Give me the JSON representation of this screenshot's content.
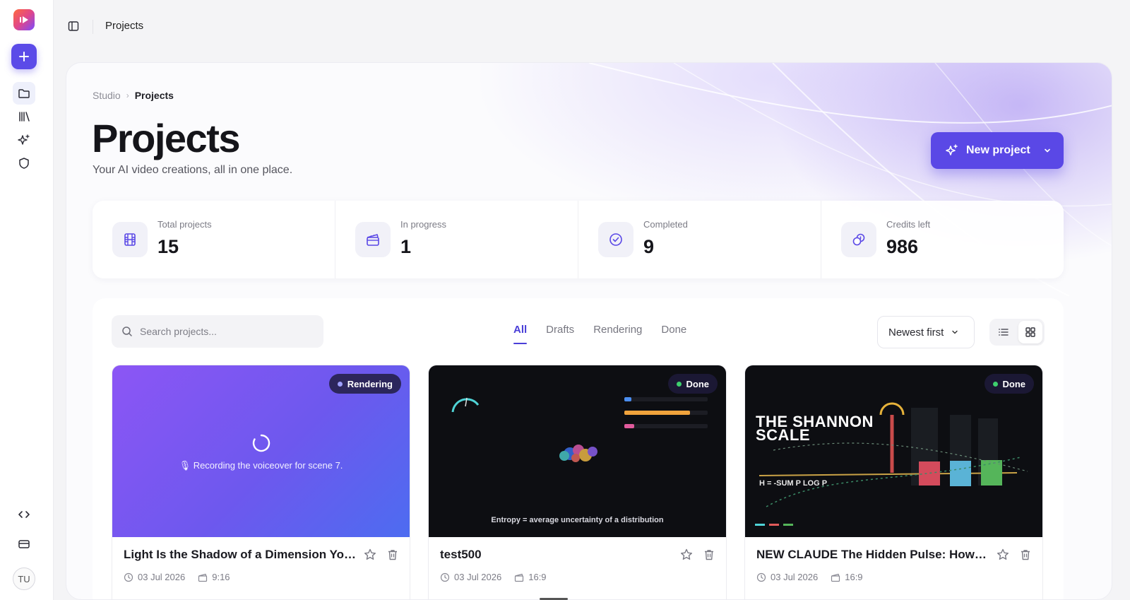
{
  "topbar": {
    "title": "Projects"
  },
  "rail": {
    "avatar_initials": "TU"
  },
  "breadcrumb": {
    "root": "Studio",
    "separator": "›",
    "current": "Projects"
  },
  "header": {
    "title": "Projects",
    "subtitle": "Your AI video creations, all in one place.",
    "new_button_label": "New project"
  },
  "stats": [
    {
      "label": "Total projects",
      "value": "15",
      "icon": "film-icon"
    },
    {
      "label": "In progress",
      "value": "1",
      "icon": "clapperboard-icon"
    },
    {
      "label": "Completed",
      "value": "9",
      "icon": "check-circle-icon"
    },
    {
      "label": "Credits left",
      "value": "986",
      "icon": "coins-icon"
    }
  ],
  "toolbar": {
    "search_placeholder": "Search projects...",
    "tabs": [
      "All",
      "Drafts",
      "Rendering",
      "Done"
    ],
    "active_tab": "All",
    "sort_label": "Newest first"
  },
  "projects": [
    {
      "title": "Light Is the Shadow of a Dimension You ...",
      "status": "Rendering",
      "status_color": "#8b8cf7",
      "date": "03 Jul 2026",
      "ratio": "9:16",
      "thumb_text": "🎙 Recording the voiceover for scene 7."
    },
    {
      "title": "test500",
      "status": "Done",
      "status_color": "#3ecf6e",
      "date": "03 Jul 2026",
      "ratio": "16:9",
      "thumb_text": "Entropy = average uncertainty of a distribution"
    },
    {
      "title": "NEW CLAUDE The Hidden Pulse: How Ent...",
      "status": "Done",
      "status_color": "#3ecf6e",
      "date": "03 Jul 2026",
      "ratio": "16:9",
      "thumb_heading_line1": "THE SHANNON",
      "thumb_heading_line2": "SCALE",
      "thumb_formula": "H = -SUM P LOG P"
    }
  ],
  "colors": {
    "accent": "#5a48e6",
    "done": "#3ecf6e",
    "rendering": "#8b8cf7"
  }
}
